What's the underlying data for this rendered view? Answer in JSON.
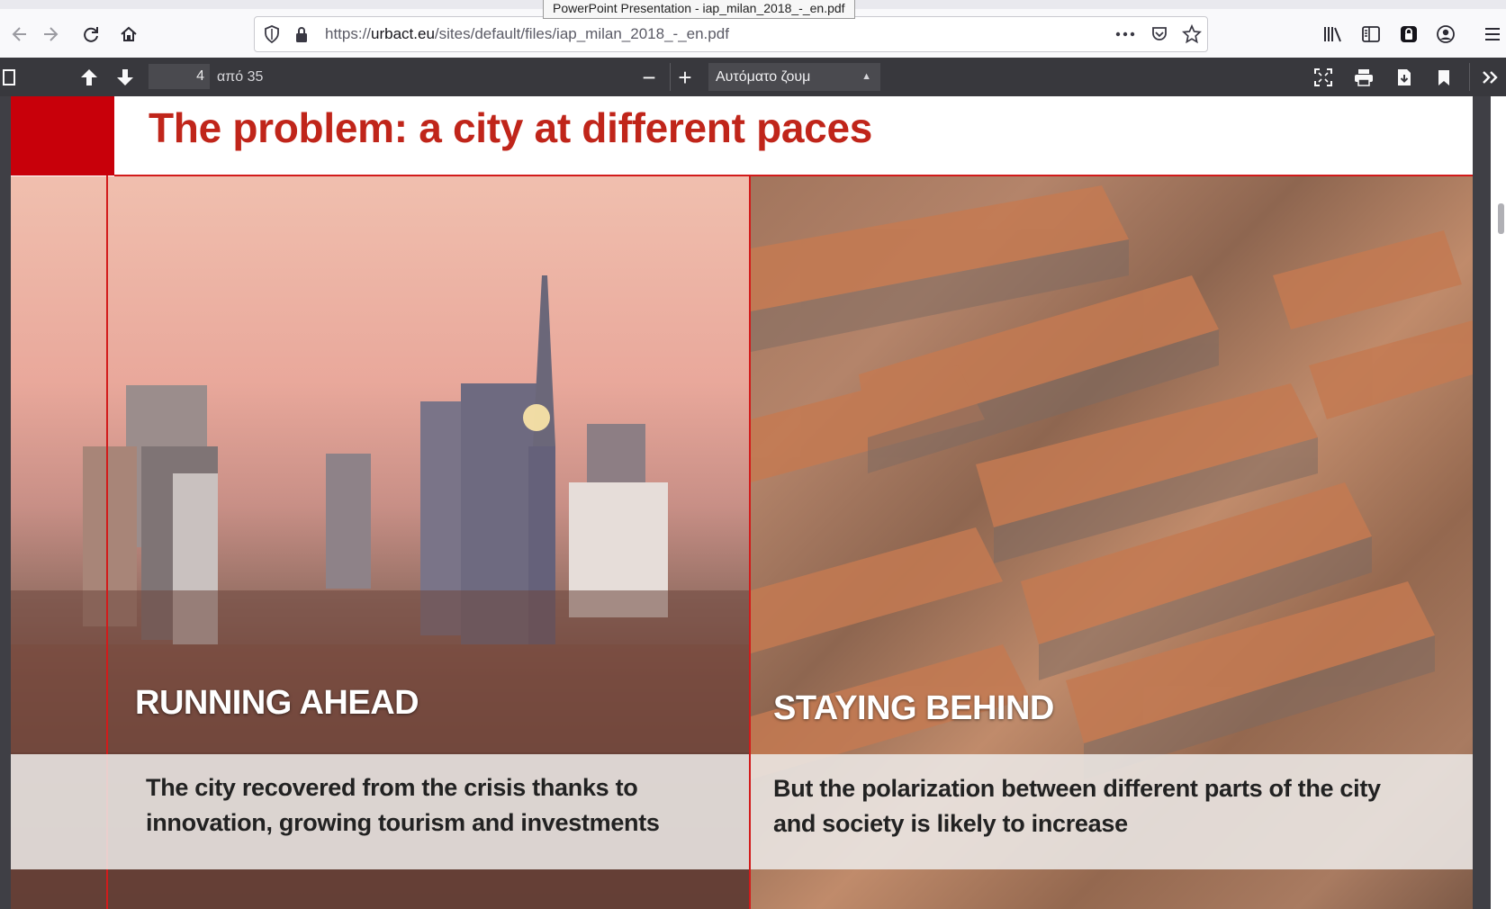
{
  "browser": {
    "tooltip": "PowerPoint Presentation - iap_milan_2018_-_en.pdf",
    "url_prefix": "https://",
    "url_domain": "urbact.eu",
    "url_path": "/sites/default/files/iap_milan_2018_-_en.pdf",
    "icons": [
      "back-icon",
      "forward-icon",
      "reload-icon",
      "home-icon",
      "shield-icon",
      "lock-icon",
      "more-icon",
      "pocket-icon",
      "star-icon",
      "library-icon",
      "sidebar-icon",
      "extension-icon",
      "account-icon",
      "menu-icon"
    ]
  },
  "pdf_toolbar": {
    "current_page": "4",
    "page_of": "από 35",
    "zoom_label": "Αυτόματο ζουμ",
    "zoom_minus": "−",
    "zoom_plus": "+"
  },
  "slide": {
    "title": "The problem: a city at different paces",
    "left": {
      "heading": "RUNNING  AHEAD",
      "body": "The city recovered from the crisis thanks to innovation, growing tourism and investments"
    },
    "right": {
      "heading": "STAYING BEHIND",
      "body": "But the polarization between different parts of the city  and society is likely to increase"
    }
  },
  "colors": {
    "accent_red": "#c8000a",
    "title_red": "#c0251a",
    "toolbar_dark": "#38383d"
  }
}
